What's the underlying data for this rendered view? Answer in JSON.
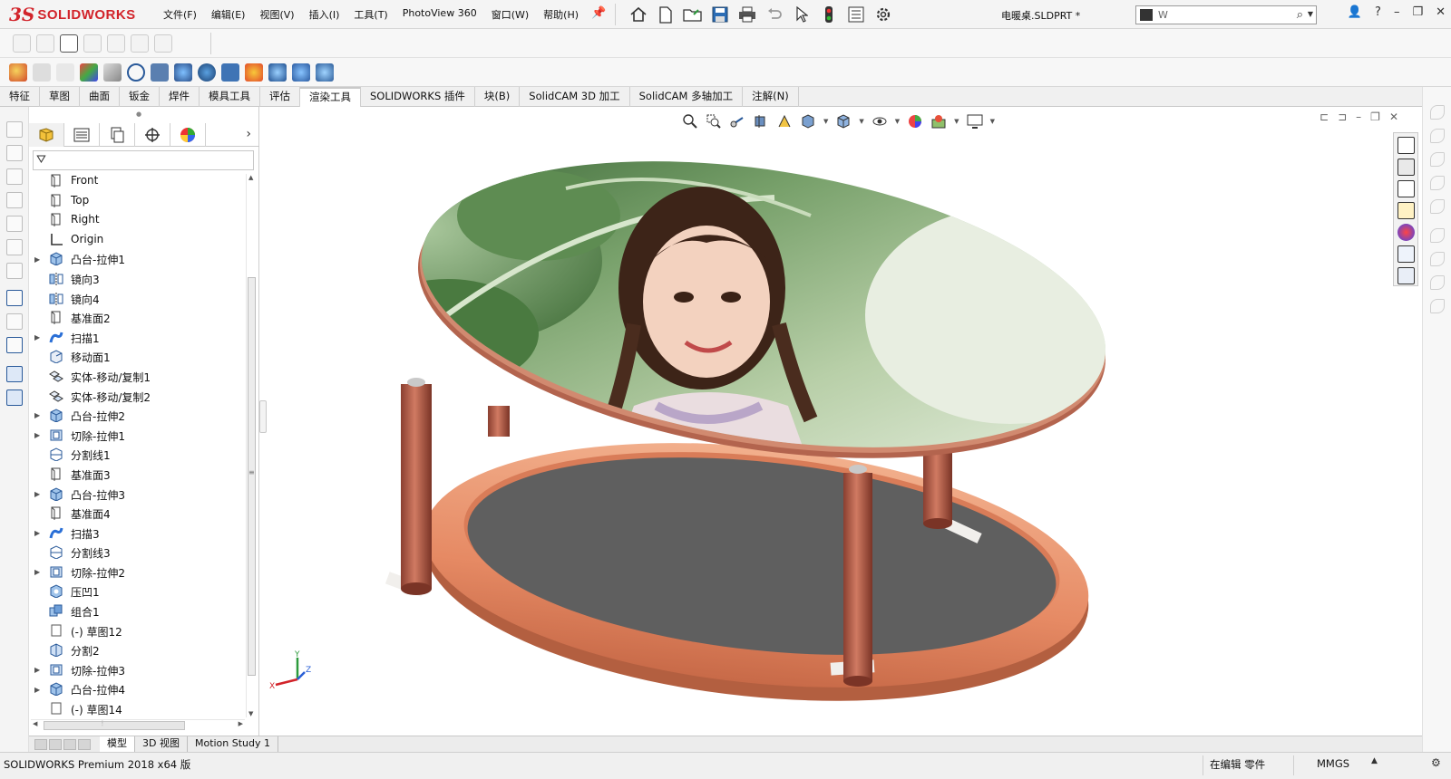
{
  "app": {
    "logo_ds": "3S",
    "logo_text": "SOLIDWORKS",
    "doc_title": "电暖桌.SLDPRT *"
  },
  "menu": [
    "文件(F)",
    "编辑(E)",
    "视图(V)",
    "插入(I)",
    "工具(T)",
    "PhotoView 360",
    "窗口(W)",
    "帮助(H)"
  ],
  "search": {
    "value": "W"
  },
  "command_tabs": [
    {
      "label": "特征"
    },
    {
      "label": "草图"
    },
    {
      "label": "曲面"
    },
    {
      "label": "钣金"
    },
    {
      "label": "焊件"
    },
    {
      "label": "模具工具"
    },
    {
      "label": "评估"
    },
    {
      "label": "渲染工具",
      "active": true
    },
    {
      "label": "SOLIDWORKS 插件"
    },
    {
      "label": "块(B)"
    },
    {
      "label": "SolidCAM 3D 加工"
    },
    {
      "label": "SolidCAM 多轴加工"
    },
    {
      "label": "注解(N)"
    }
  ],
  "feature_tree": [
    {
      "label": "Front",
      "icon": "plane-icon",
      "expandable": false
    },
    {
      "label": "Top",
      "icon": "plane-icon",
      "expandable": false
    },
    {
      "label": "Right",
      "icon": "plane-icon",
      "expandable": false
    },
    {
      "label": "Origin",
      "icon": "origin-icon",
      "expandable": false
    },
    {
      "label": "凸台-拉伸1",
      "icon": "boss-extrude-icon",
      "expandable": true
    },
    {
      "label": "镜向3",
      "icon": "mirror-icon",
      "expandable": false
    },
    {
      "label": "镜向4",
      "icon": "mirror-icon",
      "expandable": false
    },
    {
      "label": "基准面2",
      "icon": "plane-icon",
      "expandable": false
    },
    {
      "label": "扫描1",
      "icon": "sweep-icon",
      "expandable": true
    },
    {
      "label": "移动面1",
      "icon": "move-face-icon",
      "expandable": false
    },
    {
      "label": "实体-移动/复制1",
      "icon": "move-copy-body-icon",
      "expandable": false
    },
    {
      "label": "实体-移动/复制2",
      "icon": "move-copy-body-icon",
      "expandable": false
    },
    {
      "label": "凸台-拉伸2",
      "icon": "boss-extrude-icon",
      "expandable": true
    },
    {
      "label": "切除-拉伸1",
      "icon": "cut-extrude-icon",
      "expandable": true
    },
    {
      "label": "分割线1",
      "icon": "split-line-icon",
      "expandable": false
    },
    {
      "label": "基准面3",
      "icon": "plane-icon",
      "expandable": false
    },
    {
      "label": "凸台-拉伸3",
      "icon": "boss-extrude-icon",
      "expandable": true
    },
    {
      "label": "基准面4",
      "icon": "plane-icon",
      "expandable": false
    },
    {
      "label": "扫描3",
      "icon": "sweep-icon",
      "expandable": true
    },
    {
      "label": "分割线3",
      "icon": "split-line-icon",
      "expandable": false
    },
    {
      "label": "切除-拉伸2",
      "icon": "cut-extrude-icon",
      "expandable": true
    },
    {
      "label": "压凹1",
      "icon": "indent-icon",
      "expandable": false
    },
    {
      "label": "组合1",
      "icon": "combine-icon",
      "expandable": false
    },
    {
      "label": "(-) 草图12",
      "icon": "sketch-icon",
      "expandable": false
    },
    {
      "label": "分割2",
      "icon": "split-icon",
      "expandable": false
    },
    {
      "label": "切除-拉伸3",
      "icon": "cut-extrude-icon",
      "expandable": true
    },
    {
      "label": "凸台-拉伸4",
      "icon": "boss-extrude-icon",
      "expandable": true
    },
    {
      "label": "(-) 草图14",
      "icon": "sketch-icon",
      "expandable": false
    }
  ],
  "bottom_tabs": [
    {
      "label": "模型",
      "active": true
    },
    {
      "label": "3D 视图"
    },
    {
      "label": "Motion Study 1"
    }
  ],
  "status": {
    "product": "SOLIDWORKS Premium 2018 x64 版",
    "mode": "在编辑 零件",
    "units": "MMGS"
  },
  "triad": {
    "x_label": "X",
    "y_label": "Y",
    "z_label": "Z"
  },
  "colors": {
    "brand": "#d2232a",
    "table_leg": "#b5624f",
    "ring": "#e89a78",
    "base_disk": "#5f5f5f",
    "accent_blue": "#2a6fd6"
  }
}
